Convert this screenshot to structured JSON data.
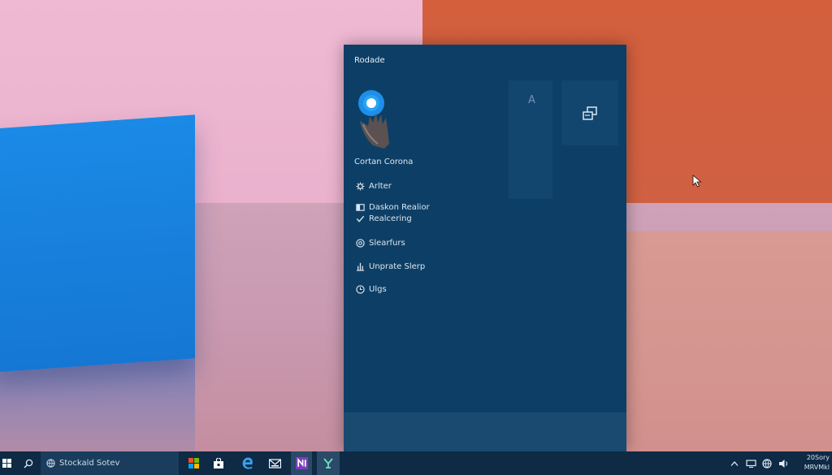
{
  "start_menu": {
    "title": "Rodade",
    "profile": {
      "name": "Cortan Corona",
      "avatar_icon": "cortana-hand-icon"
    },
    "items": [
      {
        "label": "Arlter",
        "icon": "gear-icon"
      },
      {
        "label": "Daskon Realior",
        "icon": "tile-icon"
      },
      {
        "label": "Realcering",
        "icon": "check-icon"
      },
      {
        "label": "Slearfurs",
        "icon": "settings-circle-icon"
      },
      {
        "label": "Unprate Slerp",
        "icon": "power-icon"
      },
      {
        "label": "Ulgs",
        "icon": "clock-icon"
      }
    ],
    "tiles": [
      {
        "label": "A",
        "icon": "pointer-icon"
      },
      {
        "label": "",
        "icon": "copy-windows-icon"
      }
    ]
  },
  "taskbar": {
    "search_text": "Stockald Sotev",
    "apps": [
      {
        "icon": "colorful-grid-icon"
      },
      {
        "icon": "store-bag-icon"
      },
      {
        "icon": "edge-icon"
      },
      {
        "icon": "mail-icon"
      },
      {
        "icon": "onenote-icon"
      },
      {
        "icon": "y-app-icon"
      }
    ],
    "tray": [
      {
        "icon": "chevron-up-icon"
      },
      {
        "icon": "network-icon"
      },
      {
        "icon": "globe-icon"
      },
      {
        "icon": "volume-icon"
      }
    ],
    "clock_line1": "20Sory",
    "clock_line2": "MRVMkl"
  },
  "colors": {
    "panel": "#0d3f66",
    "taskbar": "#0e2a45",
    "accent_blue": "#1a8ae6"
  }
}
